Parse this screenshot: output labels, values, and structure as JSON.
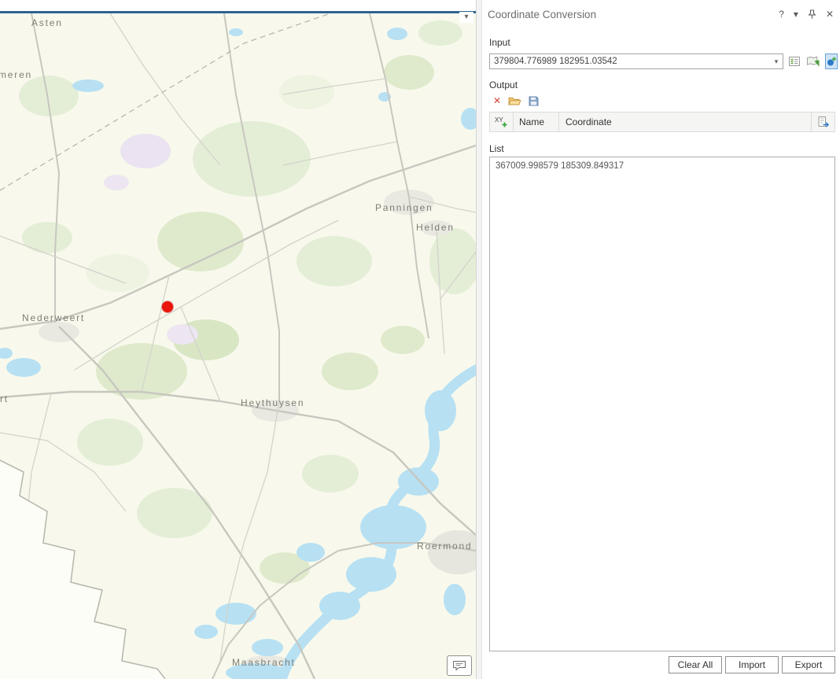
{
  "window": {
    "map_dropdown_icon": "▾"
  },
  "map": {
    "labels": [
      {
        "text": "Asten"
      },
      {
        "text": "meren"
      },
      {
        "text": "Panningen"
      },
      {
        "text": "Helden"
      },
      {
        "text": "Nederweert"
      },
      {
        "text": "rt"
      },
      {
        "text": "Heythuysen"
      },
      {
        "text": "Roermond"
      },
      {
        "text": "Maasbracht"
      }
    ],
    "marker_color": "#ea1408",
    "accent_color": "#2e6391"
  },
  "panel": {
    "title": "Coordinate Conversion",
    "header_icons": {
      "help": "?",
      "menu": "▾",
      "close": "✕"
    },
    "input": {
      "label": "Input",
      "value": "379804.776989 182951.03542",
      "dropdown_icon": "▾"
    },
    "output": {
      "label": "Output",
      "delete_icon": "✕"
    },
    "table": {
      "xy_icon": "XY",
      "name": "Name",
      "coordinate": "Coordinate"
    },
    "list": {
      "label": "List",
      "items": [
        "367009.998579 185309.849317"
      ]
    },
    "buttons": {
      "clear_all": "Clear All",
      "import": "Import",
      "export": "Export"
    }
  }
}
